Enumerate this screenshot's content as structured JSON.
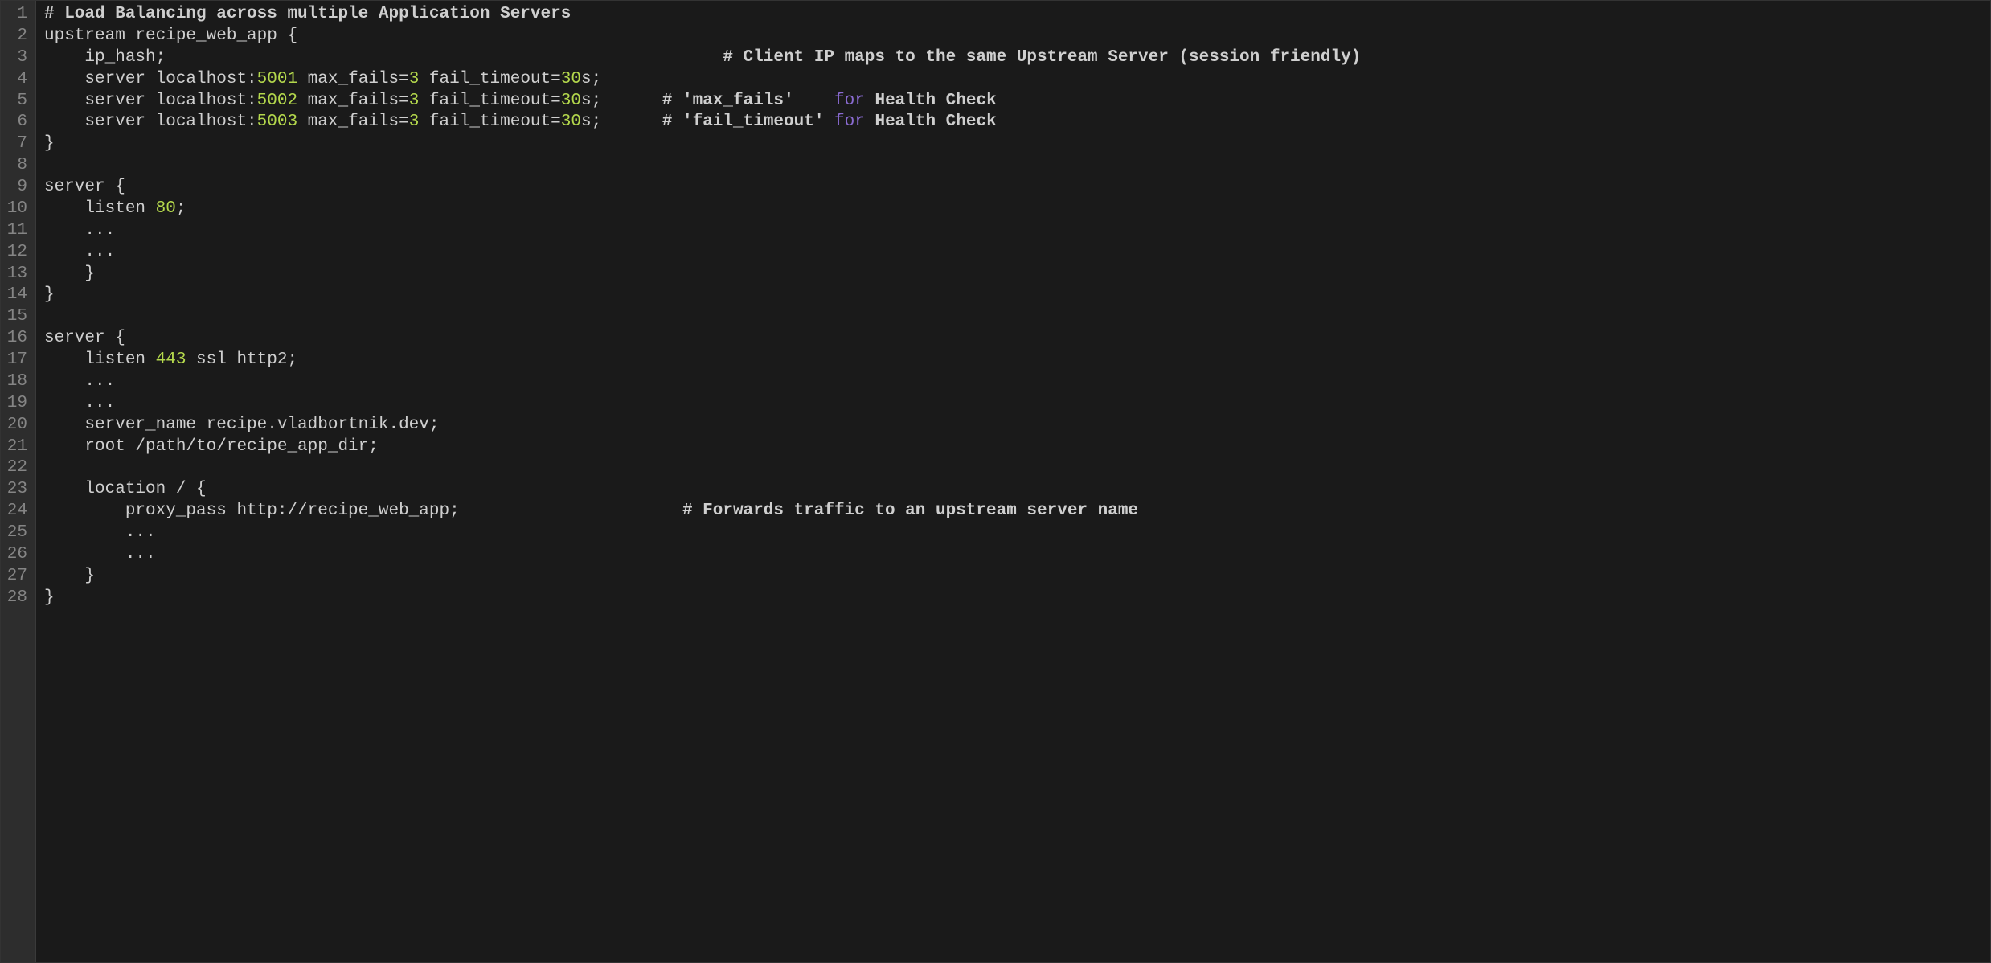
{
  "colors": {
    "background": "#1a1a1a",
    "gutter_bg": "#2d2d2d",
    "gutter_fg": "#858585",
    "text": "#cfcfcf",
    "number": "#b4d84c",
    "keyword": "#8a6bd1"
  },
  "code_lines": [
    {
      "n": "1",
      "seg": [
        {
          "t": "cmt",
          "v": "# Load Balancing across multiple Application Servers"
        }
      ]
    },
    {
      "n": "2",
      "seg": [
        {
          "t": "c",
          "v": "upstream recipe_web_app {"
        }
      ]
    },
    {
      "n": "3",
      "seg": [
        {
          "t": "c",
          "v": "    ip_hash;                                                       "
        },
        {
          "t": "cmt",
          "v": "# Client IP maps to the same Upstream Server (session friendly)"
        }
      ]
    },
    {
      "n": "4",
      "seg": [
        {
          "t": "c",
          "v": "    server localhost:"
        },
        {
          "t": "num",
          "v": "5001"
        },
        {
          "t": "c",
          "v": " max_fails="
        },
        {
          "t": "num",
          "v": "3"
        },
        {
          "t": "c",
          "v": " fail_timeout="
        },
        {
          "t": "num",
          "v": "30"
        },
        {
          "t": "c",
          "v": "s;"
        }
      ]
    },
    {
      "n": "5",
      "seg": [
        {
          "t": "c",
          "v": "    server localhost:"
        },
        {
          "t": "num",
          "v": "5002"
        },
        {
          "t": "c",
          "v": " max_fails="
        },
        {
          "t": "num",
          "v": "3"
        },
        {
          "t": "c",
          "v": " fail_timeout="
        },
        {
          "t": "num",
          "v": "30"
        },
        {
          "t": "c",
          "v": "s;      "
        },
        {
          "t": "cmt",
          "v": "# 'max_fails'    "
        },
        {
          "t": "kw",
          "v": "for"
        },
        {
          "t": "cmt",
          "v": " Health Check"
        }
      ]
    },
    {
      "n": "6",
      "seg": [
        {
          "t": "c",
          "v": "    server localhost:"
        },
        {
          "t": "num",
          "v": "5003"
        },
        {
          "t": "c",
          "v": " max_fails="
        },
        {
          "t": "num",
          "v": "3"
        },
        {
          "t": "c",
          "v": " fail_timeout="
        },
        {
          "t": "num",
          "v": "30"
        },
        {
          "t": "c",
          "v": "s;      "
        },
        {
          "t": "cmt",
          "v": "# 'fail_timeout' "
        },
        {
          "t": "kw",
          "v": "for"
        },
        {
          "t": "cmt",
          "v": " Health Check"
        }
      ]
    },
    {
      "n": "7",
      "seg": [
        {
          "t": "c",
          "v": "}"
        }
      ]
    },
    {
      "n": "8",
      "seg": [
        {
          "t": "c",
          "v": ""
        }
      ]
    },
    {
      "n": "9",
      "seg": [
        {
          "t": "c",
          "v": "server {"
        }
      ]
    },
    {
      "n": "10",
      "seg": [
        {
          "t": "c",
          "v": "    listen "
        },
        {
          "t": "num",
          "v": "80"
        },
        {
          "t": "c",
          "v": ";"
        }
      ]
    },
    {
      "n": "11",
      "seg": [
        {
          "t": "c",
          "v": "    ..."
        }
      ]
    },
    {
      "n": "12",
      "seg": [
        {
          "t": "c",
          "v": "    ..."
        }
      ]
    },
    {
      "n": "13",
      "seg": [
        {
          "t": "c",
          "v": "    }"
        }
      ]
    },
    {
      "n": "14",
      "seg": [
        {
          "t": "c",
          "v": "}"
        }
      ]
    },
    {
      "n": "15",
      "seg": [
        {
          "t": "c",
          "v": ""
        }
      ]
    },
    {
      "n": "16",
      "seg": [
        {
          "t": "c",
          "v": "server {"
        }
      ]
    },
    {
      "n": "17",
      "seg": [
        {
          "t": "c",
          "v": "    listen "
        },
        {
          "t": "num",
          "v": "443"
        },
        {
          "t": "c",
          "v": " ssl http2;"
        }
      ]
    },
    {
      "n": "18",
      "seg": [
        {
          "t": "c",
          "v": "    ..."
        }
      ]
    },
    {
      "n": "19",
      "seg": [
        {
          "t": "c",
          "v": "    ..."
        }
      ]
    },
    {
      "n": "20",
      "seg": [
        {
          "t": "c",
          "v": "    server_name recipe.vladbortnik.dev;"
        }
      ]
    },
    {
      "n": "21",
      "seg": [
        {
          "t": "c",
          "v": "    root /path/to/recipe_app_dir;"
        }
      ]
    },
    {
      "n": "22",
      "seg": [
        {
          "t": "c",
          "v": ""
        }
      ]
    },
    {
      "n": "23",
      "seg": [
        {
          "t": "c",
          "v": "    location / {"
        }
      ]
    },
    {
      "n": "24",
      "seg": [
        {
          "t": "c",
          "v": "        proxy_pass http://recipe_web_app;                      "
        },
        {
          "t": "cmt",
          "v": "# Forwards traffic to an upstream server name"
        }
      ]
    },
    {
      "n": "25",
      "seg": [
        {
          "t": "c",
          "v": "        ..."
        }
      ]
    },
    {
      "n": "26",
      "seg": [
        {
          "t": "c",
          "v": "        ..."
        }
      ]
    },
    {
      "n": "27",
      "seg": [
        {
          "t": "c",
          "v": "    }"
        }
      ]
    },
    {
      "n": "28",
      "seg": [
        {
          "t": "c",
          "v": "}"
        }
      ]
    }
  ]
}
